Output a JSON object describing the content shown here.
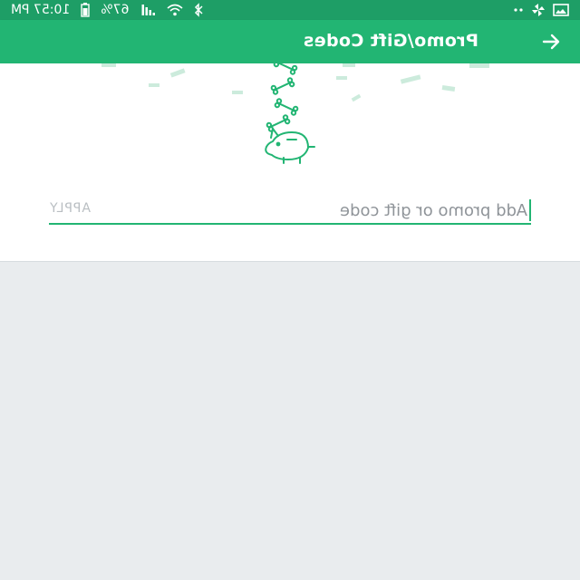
{
  "status_bar": {
    "time": "10:57 PM",
    "battery_percent": "67%",
    "icons": [
      "gallery-icon",
      "pinwheel-icon",
      "more-dots-icon",
      "bluetooth-icon",
      "wifi-icon",
      "signal-icon",
      "battery-icon"
    ]
  },
  "app_bar": {
    "title": "Promo/Gift Codes",
    "back_icon": "arrow-back-icon",
    "color": "#22b573"
  },
  "promo": {
    "placeholder": "Add promo or gift code",
    "apply_label": "APPLY"
  },
  "illustration": {
    "icon": "piggy-bank-icon",
    "accent": "#22b573"
  }
}
